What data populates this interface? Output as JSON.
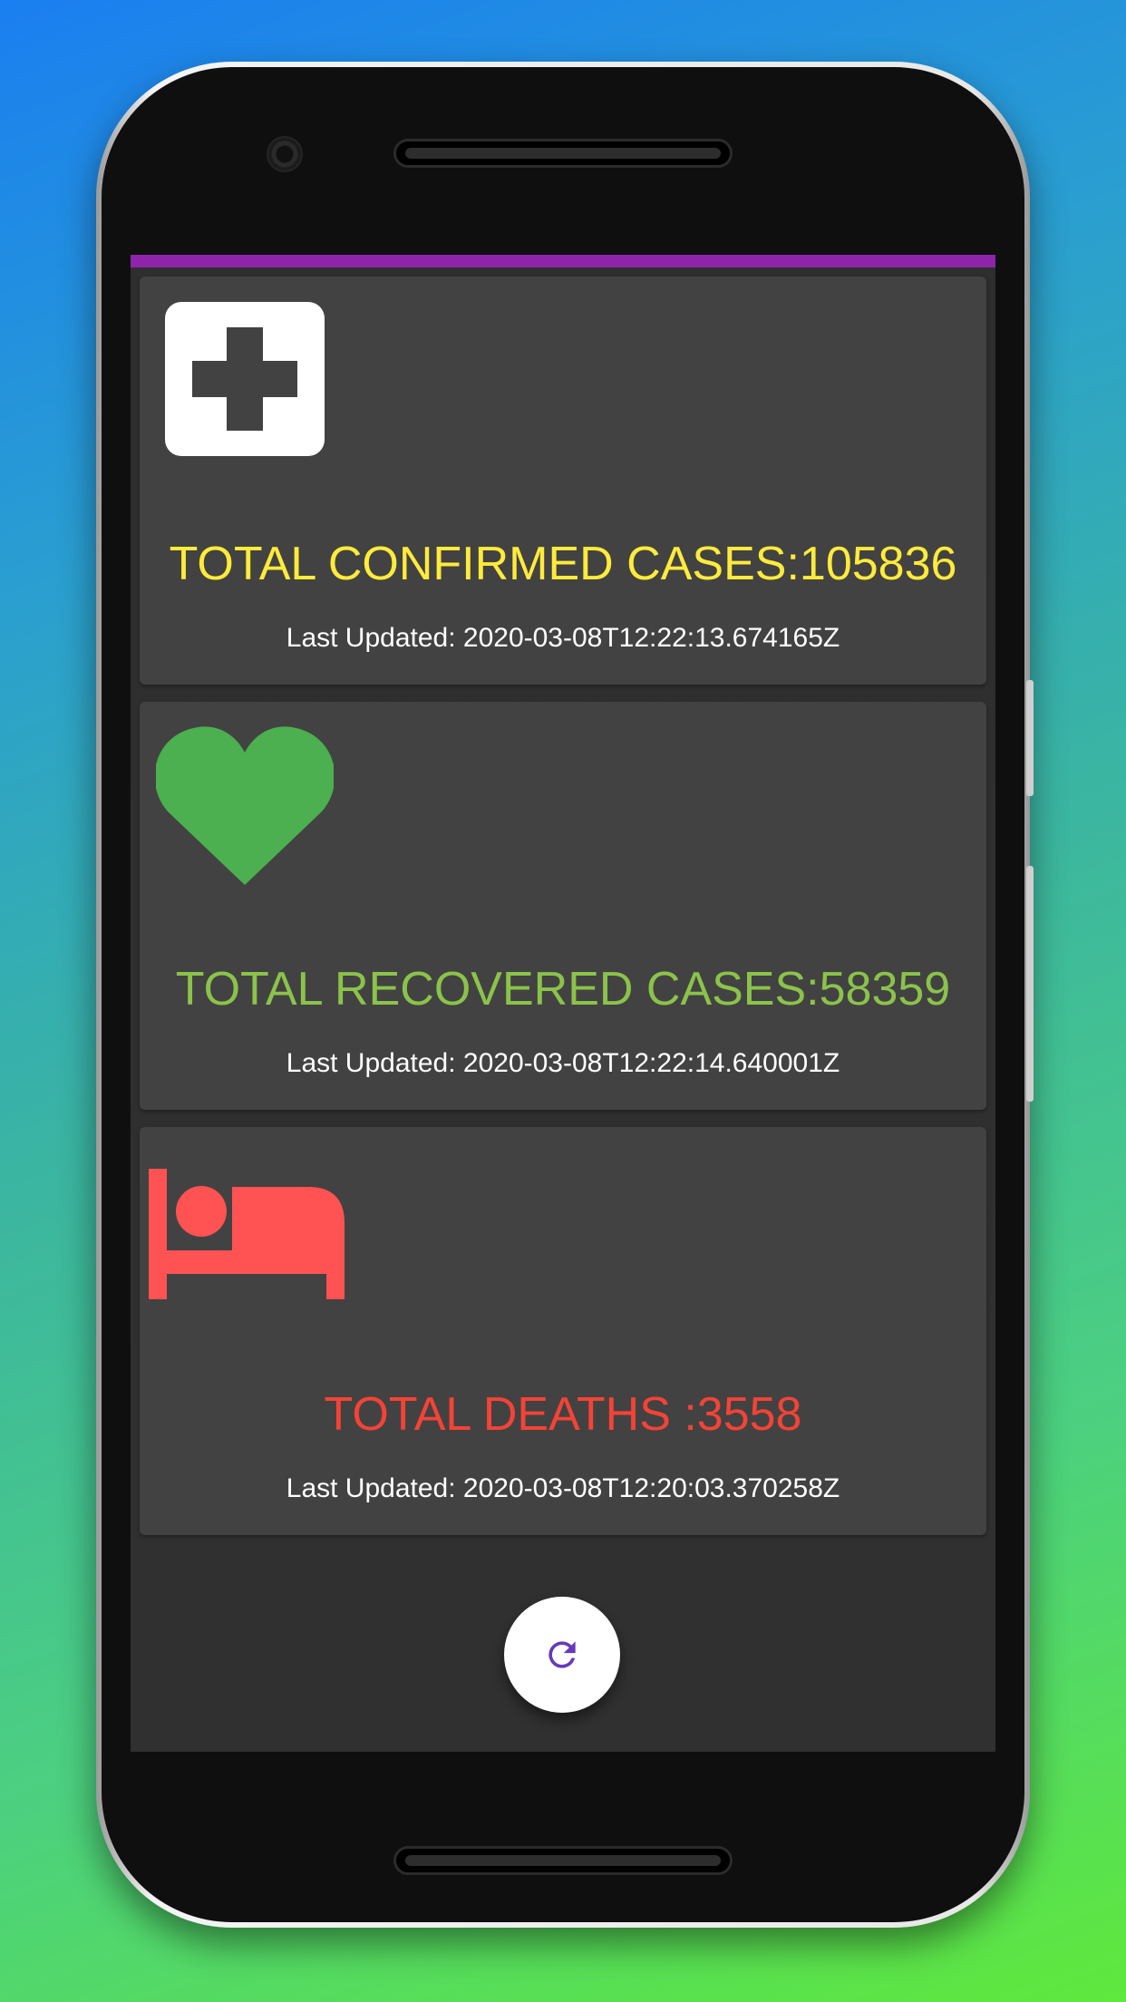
{
  "cards": [
    {
      "title": "TOTAL CONFIRMED CASES:105836",
      "updated": "Last Updated: 2020-03-08T12:22:13.674165Z",
      "icon": "medical-cross-icon",
      "color": "#ffeb3b"
    },
    {
      "title": "TOTAL RECOVERED CASES:58359",
      "updated": "Last Updated: 2020-03-08T12:22:14.640001Z",
      "icon": "heart-icon",
      "color": "#8bc34a"
    },
    {
      "title": "TOTAL DEATHS :3558",
      "updated": "Last Updated: 2020-03-08T12:20:03.370258Z",
      "icon": "bed-icon",
      "color": "#f44336"
    }
  ],
  "fab": {
    "icon": "refresh-icon",
    "color": "#673ab7"
  },
  "appbar": {
    "color": "#8e24aa"
  }
}
